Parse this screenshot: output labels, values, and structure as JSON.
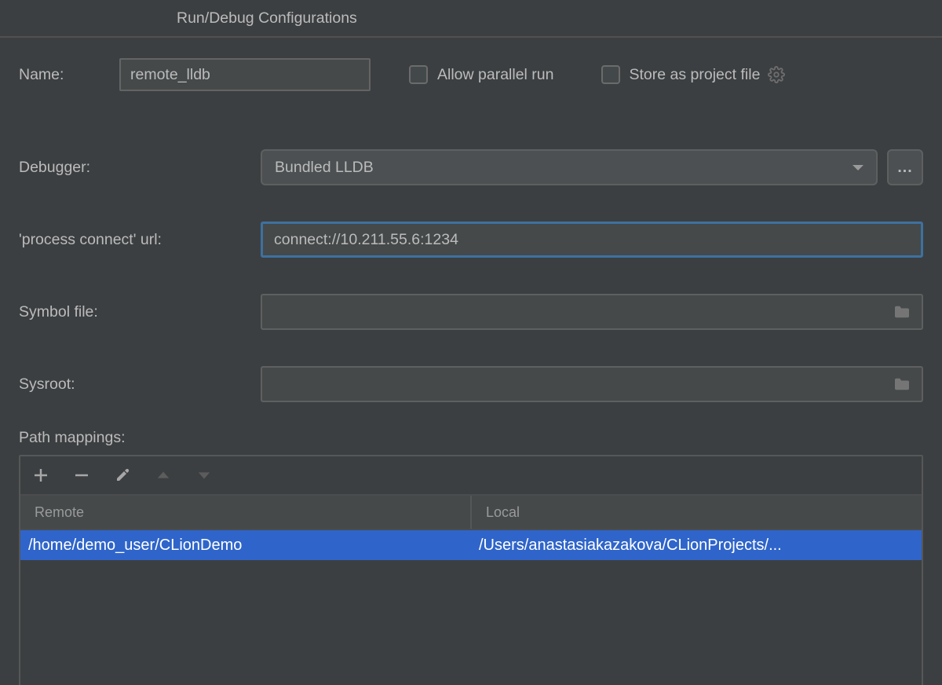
{
  "title": "Run/Debug Configurations",
  "name": {
    "label": "Name:",
    "value": "remote_lldb"
  },
  "options": {
    "allow_parallel": {
      "label": "Allow parallel run",
      "checked": false
    },
    "store_project": {
      "label": "Store as project file",
      "checked": false
    }
  },
  "debugger": {
    "label": "Debugger:",
    "selected": "Bundled LLDB"
  },
  "process_connect": {
    "label": "'process connect' url:",
    "value": "connect://10.211.55.6:1234"
  },
  "symbol_file": {
    "label": "Symbol file:",
    "value": ""
  },
  "sysroot": {
    "label": "Sysroot:",
    "value": ""
  },
  "path_mappings": {
    "label": "Path mappings:",
    "headers": {
      "remote": "Remote",
      "local": "Local"
    },
    "rows": [
      {
        "remote": "/home/demo_user/CLionDemo",
        "local": "/Users/anastasiakazakova/CLionProjects/..."
      }
    ]
  },
  "ellipsis": "..."
}
